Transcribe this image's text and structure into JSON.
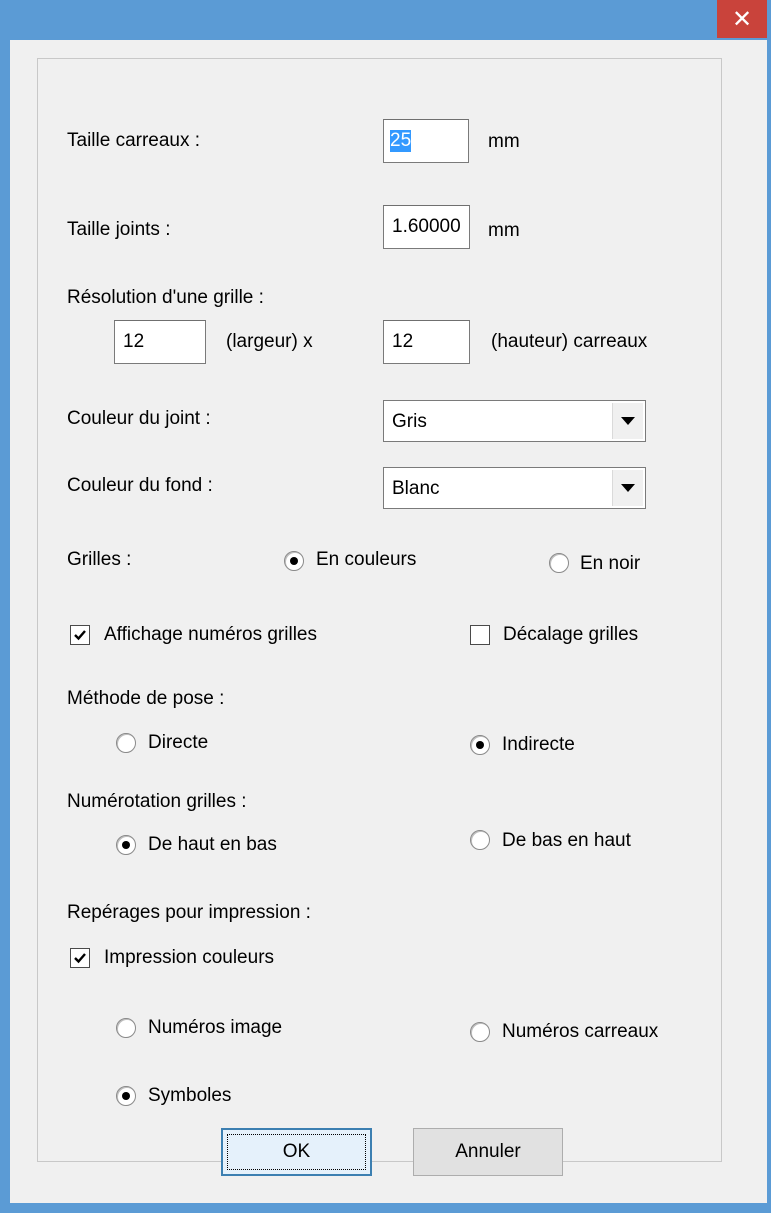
{
  "window": {
    "close_glyph": "✕"
  },
  "tile_size": {
    "label": "Taille carreaux :",
    "value": "25",
    "unit": "mm"
  },
  "joint_size": {
    "label": "Taille joints :",
    "value": "1.60000",
    "unit": "mm"
  },
  "grid_resolution": {
    "label": "Résolution d'une grille :",
    "width_value": "12",
    "width_label": "(largeur) x",
    "height_value": "12",
    "height_label": "(hauteur) carreaux"
  },
  "joint_color": {
    "label": "Couleur du joint :",
    "selected": "Gris"
  },
  "background_color": {
    "label": "Couleur du fond :",
    "selected": "Blanc"
  },
  "grids": {
    "label": "Grilles :",
    "options": [
      {
        "label": "En couleurs",
        "selected": true
      },
      {
        "label": "En noir",
        "selected": false
      }
    ]
  },
  "show_grid_numbers": {
    "label": "Affichage numéros grilles",
    "checked": true
  },
  "grid_offset": {
    "label": "Décalage grilles",
    "checked": false
  },
  "laying_method": {
    "label": "Méthode de pose :",
    "options": [
      {
        "label": "Directe",
        "selected": false
      },
      {
        "label": "Indirecte",
        "selected": true
      }
    ]
  },
  "grid_numbering": {
    "label": "Numérotation grilles :",
    "options": [
      {
        "label": "De haut en bas",
        "selected": true
      },
      {
        "label": "De bas en haut",
        "selected": false
      }
    ]
  },
  "print_markers": {
    "label": "Repérages pour impression :",
    "color_print": {
      "label": "Impression couleurs",
      "checked": true
    },
    "options": [
      {
        "label": "Numéros image",
        "selected": false
      },
      {
        "label": "Numéros carreaux",
        "selected": false
      },
      {
        "label": "Symboles",
        "selected": true
      }
    ]
  },
  "buttons": {
    "ok": "OK",
    "cancel": "Annuler"
  },
  "colors": {
    "title_bar": "#5b9bd5",
    "close_button": "#c9433b",
    "selection": "#3399ff",
    "dialog_bg": "#f0f0f0"
  }
}
